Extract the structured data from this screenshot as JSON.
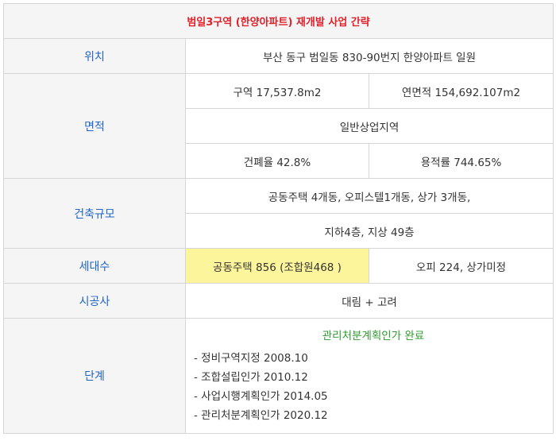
{
  "title": "범일3구역 (한양아파트) 재개발 사업 간략",
  "location": {
    "label": "위치",
    "value": "부산 동구 범일동 830-90번지 한양아파트 일원"
  },
  "area": {
    "label": "면적",
    "district_area": "구역 17,537.8m2",
    "floor_area": "연면적 154,692.107m2",
    "zoning": "일반상업지역",
    "coverage_ratio": "건폐율 42.8%",
    "floor_area_ratio": "용적률 744.65%"
  },
  "scale": {
    "label": "건축규모",
    "buildings": "공동주택 4개동, 오피스텔1개동, 상가 3개동,",
    "floors": "지하4층, 지상 49층"
  },
  "households": {
    "label": "세대수",
    "apartments": "공동주택 856 (조합원468 )",
    "others": "오피 224, 상가미정"
  },
  "contractor": {
    "label": "시공사",
    "value": "대림 + 고려"
  },
  "stage": {
    "label": "단계",
    "status": "관리처분계획인가 완료",
    "history": [
      "정비구역지정 2008.10",
      "조합설립인가 2010.12",
      "사업시행계획인가 2014.05",
      "관리처분계획인가 2020.12"
    ]
  },
  "colors": {
    "title": "#e0202a",
    "label": "#1f63c7",
    "status": "#2e9a2e",
    "highlight": "#fdf59b",
    "border": "#d6d6d6",
    "label_background": "#f5f5f5"
  }
}
